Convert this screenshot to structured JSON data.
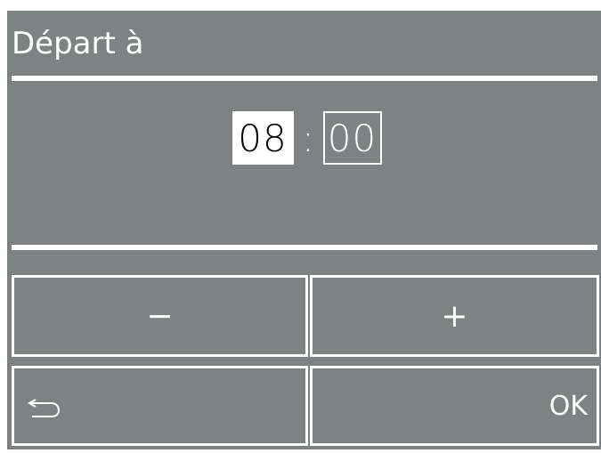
{
  "header": {
    "title": "Départ à"
  },
  "time": {
    "hours": "08",
    "separator": ":",
    "minutes": "00"
  },
  "buttons": {
    "minus": "−",
    "plus": "+",
    "ok": "OK",
    "back_icon": "back-arrow-icon"
  },
  "colors": {
    "screen_background": "#7e8282",
    "foreground": "#ffffff"
  }
}
